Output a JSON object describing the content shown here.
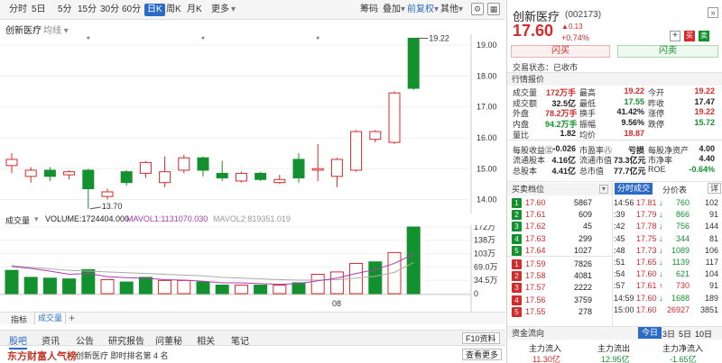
{
  "toolbar": {
    "periods": [
      "分时",
      "5日",
      "5分",
      "15分",
      "30分",
      "60分",
      "日K",
      "周K",
      "月K",
      "更多"
    ],
    "active_period": "日K",
    "tools": [
      "筹码",
      "叠加",
      "前复权",
      "其他"
    ]
  },
  "chart": {
    "stock_name": "创新医疗",
    "ma_label": "均线",
    "price_axis": [
      "19.00",
      "18.00",
      "17.00",
      "16.00",
      "15.00",
      "14.00"
    ],
    "high_mark": "19.22",
    "low_mark": "13.70"
  },
  "volume": {
    "title": "成交量",
    "volume_label": "VOLUME:1724404.000",
    "mavol1_label": "MAVOL1:1131070.030",
    "mavol2_label": "MAVOL2:819351.019",
    "axis": [
      "172万",
      "138万",
      "103万",
      "69.0万",
      "34.5万",
      "0"
    ],
    "x_label": "08"
  },
  "indicator_tabs": [
    "指标",
    "成交量"
  ],
  "news": {
    "tabs": [
      "股吧",
      "资讯",
      "公告",
      "研究报告",
      "问董秘",
      "相关",
      "笔记"
    ],
    "f10": "F10资料",
    "logo": "东方财富人气榜",
    "headline": "创新医疗  即时排名第 4 名",
    "more": "查看更多"
  },
  "quote": {
    "name": "创新医疗",
    "code": "(002173)",
    "price": "17.60",
    "change": "0.13",
    "change_pct": "+0.74%",
    "buy": "闪买",
    "sell": "闪卖",
    "status": "交易状态：已收市",
    "section": "行情报价",
    "rows": [
      [
        "成交量",
        "172万手",
        "最高",
        "19.22",
        "今开",
        "19.22"
      ],
      [
        "成交额",
        "32.5亿",
        "最低",
        "17.55",
        "昨收",
        "17.47"
      ],
      [
        "外盘",
        "78.2万手",
        "换手",
        "41.42%",
        "涨停",
        "19.22"
      ],
      [
        "内盘",
        "94.2万手",
        "振幅",
        "9.56%",
        "跌停",
        "15.72"
      ],
      [
        "量比",
        "1.82",
        "均价",
        "18.87",
        "",
        ""
      ],
      [
        "每股收益㊂",
        "-0.026",
        "市盈率㊇",
        "亏损",
        "每股净资产",
        "4.00"
      ],
      [
        "流通股本",
        "4.16亿",
        "流通市值",
        "73.3亿元",
        "市净率",
        "4.40"
      ],
      [
        "总股本",
        "4.41亿",
        "总市值",
        "77.7亿元",
        "ROE",
        "-0.64%"
      ]
    ],
    "row_colors": [
      [
        "",
        "red",
        "",
        "red",
        "",
        "red"
      ],
      [
        "",
        "",
        "",
        "green",
        "",
        ""
      ],
      [
        "",
        "red",
        "",
        "",
        "",
        "red"
      ],
      [
        "",
        "green",
        "",
        "",
        "",
        "green"
      ],
      [
        "",
        "",
        "",
        "red",
        "",
        ""
      ],
      [
        "",
        "",
        "",
        "",
        "",
        ""
      ],
      [
        "",
        "",
        "",
        "",
        "",
        ""
      ],
      [
        "",
        "",
        "",
        "",
        "",
        "green"
      ]
    ]
  },
  "orderbook": {
    "title": "买卖档位",
    "asks": [
      {
        "n": "5",
        "price": "17.64",
        "vol": "1027"
      },
      {
        "n": "4",
        "price": "17.63",
        "vol": "299"
      },
      {
        "n": "3",
        "price": "17.62",
        "vol": "45"
      },
      {
        "n": "2",
        "price": "17.61",
        "vol": "609"
      },
      {
        "n": "1",
        "price": "17.60",
        "vol": "5867"
      }
    ],
    "bids": [
      {
        "n": "1",
        "price": "17.59",
        "vol": "7826"
      },
      {
        "n": "2",
        "price": "17.58",
        "vol": "4081"
      },
      {
        "n": "3",
        "price": "17.57",
        "vol": "2222"
      },
      {
        "n": "4",
        "price": "17.56",
        "vol": "3759"
      },
      {
        "n": "5",
        "price": "17.55",
        "vol": "278"
      }
    ]
  },
  "trades": {
    "tabs": [
      "分时成交",
      "分价表",
      "详"
    ],
    "rows": [
      {
        "t": "14:56",
        "p": "17.81",
        "d": "↓",
        "v": "760",
        "c": "102"
      },
      {
        "t": ":39",
        "p": "17.79",
        "d": "↓",
        "v": "866",
        "c": "91"
      },
      {
        "t": ":42",
        "p": "17.78",
        "d": "↓",
        "v": "756",
        "c": "144"
      },
      {
        "t": ":45",
        "p": "17.75",
        "d": "↓",
        "v": "344",
        "c": "81"
      },
      {
        "t": ":48",
        "p": "17.73",
        "d": "↓",
        "v": "1089",
        "c": "106"
      },
      {
        "t": ":51",
        "p": "17.65",
        "d": "↓",
        "v": "1139",
        "c": "117"
      },
      {
        "t": ":54",
        "p": "17.60",
        "d": "↓",
        "v": "621",
        "c": "104"
      },
      {
        "t": ":57",
        "p": "17.61",
        "d": "↑",
        "v": "730",
        "c": "91"
      },
      {
        "t": "14:59",
        "p": "17.60",
        "d": "↓",
        "v": "1688",
        "c": "189"
      },
      {
        "t": "15:00",
        "p": "17.60",
        "d": "",
        "v": "26927",
        "c": "3851"
      }
    ]
  },
  "flow": {
    "title": "资金流向",
    "tabs": [
      "今日",
      "3日",
      "5日",
      "10日"
    ],
    "labels": [
      "主力流入",
      "主力流出",
      "主力净流入"
    ],
    "values": [
      "11.30亿",
      "12.95亿",
      "-1.65亿"
    ]
  },
  "colors": {
    "up": "#d52a2a",
    "down": "#14912f",
    "accent": "#2b6bc7"
  },
  "candles": [
    {
      "o": 15.1,
      "c": 15.3,
      "h": 15.5,
      "l": 14.85
    },
    {
      "o": 14.75,
      "c": 14.95,
      "h": 15.05,
      "l": 14.55
    },
    {
      "o": 14.95,
      "c": 14.75,
      "h": 15.05,
      "l": 14.6
    },
    {
      "o": 14.8,
      "c": 14.9,
      "h": 14.95,
      "l": 14.65
    },
    {
      "o": 14.95,
      "c": 14.35,
      "h": 15.0,
      "l": 13.7
    },
    {
      "o": 14.1,
      "c": 14.25,
      "h": 14.35,
      "l": 14.0
    },
    {
      "o": 14.9,
      "c": 14.55,
      "h": 14.95,
      "l": 14.45
    },
    {
      "o": 14.85,
      "c": 15.2,
      "h": 15.25,
      "l": 14.7
    },
    {
      "o": 14.55,
      "c": 14.9,
      "h": 15.4,
      "l": 14.4
    },
    {
      "o": 14.95,
      "c": 15.35,
      "h": 15.45,
      "l": 14.85
    },
    {
      "o": 15.35,
      "c": 14.95,
      "h": 15.4,
      "l": 14.75
    },
    {
      "o": 14.85,
      "c": 14.7,
      "h": 15.25,
      "l": 14.6
    },
    {
      "o": 14.6,
      "c": 14.85,
      "h": 14.9,
      "l": 14.55
    },
    {
      "o": 14.85,
      "c": 14.65,
      "h": 14.9,
      "l": 14.6
    },
    {
      "o": 14.55,
      "c": 14.65,
      "h": 14.8,
      "l": 14.5
    },
    {
      "o": 15.3,
      "c": 14.7,
      "h": 15.5,
      "l": 14.55
    },
    {
      "o": 14.95,
      "c": 15.0,
      "h": 15.8,
      "l": 14.6
    },
    {
      "o": 14.75,
      "c": 15.3,
      "h": 15.35,
      "l": 14.4
    },
    {
      "o": 14.95,
      "c": 16.2,
      "h": 16.25,
      "l": 14.9
    },
    {
      "o": 15.95,
      "c": 16.2,
      "h": 16.25,
      "l": 15.85
    },
    {
      "o": 15.85,
      "c": 17.45,
      "h": 17.5,
      "l": 15.8
    },
    {
      "o": 19.22,
      "c": 17.6,
      "h": 19.22,
      "l": 17.55
    }
  ],
  "volumes": [
    {
      "v": 60,
      "up": false
    },
    {
      "v": 42,
      "up": false
    },
    {
      "v": 40,
      "up": false
    },
    {
      "v": 38,
      "up": false
    },
    {
      "v": 62,
      "up": false
    },
    {
      "v": 36,
      "up": true
    },
    {
      "v": 30,
      "up": false
    },
    {
      "v": 42,
      "up": false
    },
    {
      "v": 34,
      "up": true
    },
    {
      "v": 34,
      "up": true
    },
    {
      "v": 30,
      "up": false
    },
    {
      "v": 22,
      "up": false
    },
    {
      "v": 22,
      "up": true
    },
    {
      "v": 22,
      "up": false
    },
    {
      "v": 22,
      "up": true
    },
    {
      "v": 28,
      "up": false
    },
    {
      "v": 50,
      "up": true
    },
    {
      "v": 56,
      "up": true
    },
    {
      "v": 78,
      "up": true
    },
    {
      "v": 82,
      "up": false
    },
    {
      "v": 106,
      "up": true
    },
    {
      "v": 172,
      "up": false
    }
  ],
  "mavol1": [
    70,
    65,
    58,
    50,
    52,
    44,
    41,
    40,
    36,
    35,
    32,
    28,
    28,
    26,
    24,
    26,
    33,
    40,
    52,
    62,
    78,
    102
  ],
  "mavol2": [
    72,
    68,
    64,
    60,
    58,
    56,
    54,
    52,
    50,
    48,
    46,
    42,
    40,
    38,
    36,
    35,
    35,
    36,
    40,
    45,
    55,
    80
  ]
}
